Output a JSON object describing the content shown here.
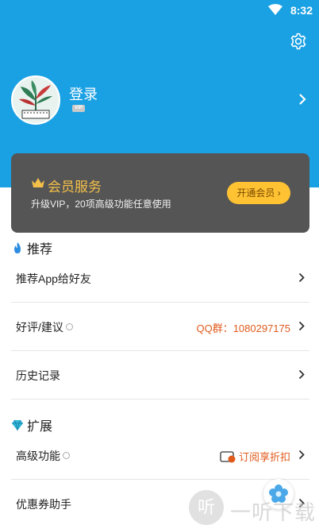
{
  "status_bar": {
    "time": "8:32",
    "wifi_icon": "wifi-icon"
  },
  "header": {
    "settings_icon": "gear-icon",
    "background_color": "#1aa1e3"
  },
  "profile": {
    "login_label": "登录",
    "vip_badge": "VIP"
  },
  "vip_card": {
    "title": "会员服务",
    "subtitle": "升级VIP，20项高级功能任意使用",
    "button_label": "开通会员 ›",
    "accent_color": "#f5c049",
    "button_color": "#ffc233"
  },
  "sections": {
    "recommend": {
      "title": "推荐",
      "icon": "flame-icon"
    },
    "extend": {
      "title": "扩展",
      "icon": "diamond-icon"
    }
  },
  "rows": {
    "recommend_app": {
      "label": "推荐App给好友"
    },
    "feedback": {
      "label": "好评/建议",
      "right_text": "QQ群：1080297175"
    },
    "history": {
      "label": "历史记录"
    },
    "advanced": {
      "label": "高级功能",
      "right_text": "订阅享折扣"
    },
    "coupon": {
      "label": "优惠券助手"
    }
  },
  "watermark": {
    "glyph": "听",
    "text": "一听下载"
  }
}
